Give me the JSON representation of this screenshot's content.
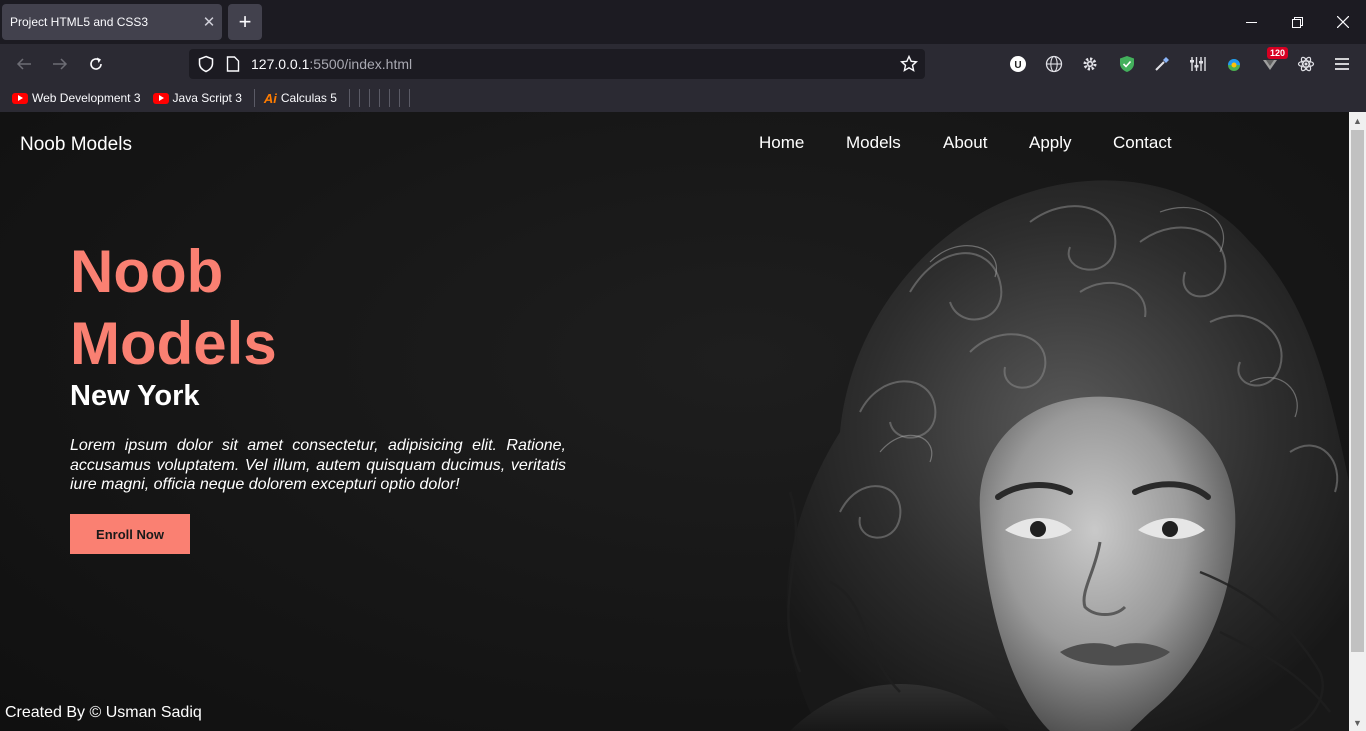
{
  "browser": {
    "tab_title": "Project HTML5 and CSS3",
    "url_host": "127.0.0.1",
    "url_rest": ":5500/index.html",
    "extension_badge": "120",
    "bookmarks": [
      {
        "label": "Web Development 3",
        "icon": "youtube-icon"
      },
      {
        "label": "Java Script 3",
        "icon": "youtube-icon"
      },
      {
        "label": "Calculas 5",
        "icon": "ai-icon"
      }
    ],
    "ai_icon_text": "Ai"
  },
  "page": {
    "brand": "Noob Models",
    "nav": [
      "Home",
      "Models",
      "About",
      "Apply",
      "Contact"
    ],
    "hero_title_line1": "Noob",
    "hero_title_line2": "Models",
    "hero_subtitle": "New York",
    "hero_text": "Lorem ipsum dolor sit amet consectetur, adipisicing elit. Ratione, accusamus voluptatem. Vel illum, autem quisquam ducimus, veritatis iure magni, officia neque dolorem excepturi optio dolor!",
    "cta": "Enroll Now",
    "footer": "Created By © Usman Sadiq"
  },
  "colors": {
    "accent": "#fa8072",
    "page_bg": "#161616",
    "browser_bg": "#1c1b22"
  }
}
